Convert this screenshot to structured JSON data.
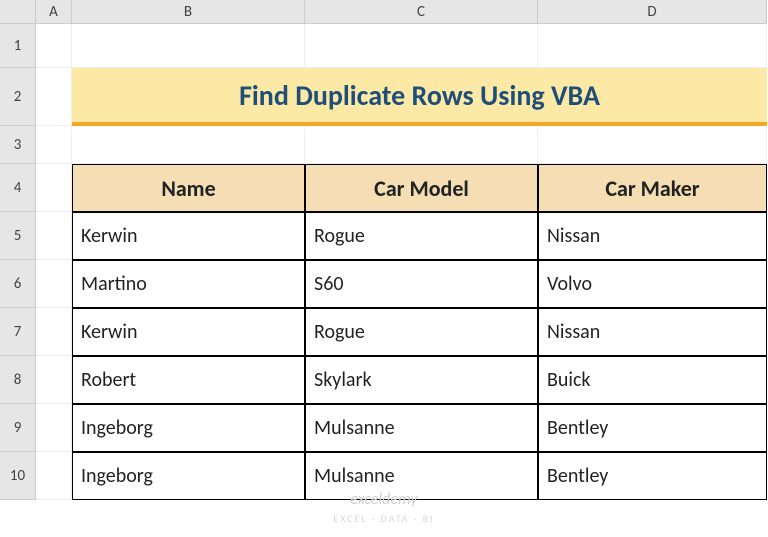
{
  "columns": [
    "A",
    "B",
    "C",
    "D"
  ],
  "rows": [
    "1",
    "2",
    "3",
    "4",
    "5",
    "6",
    "7",
    "8",
    "9",
    "10"
  ],
  "title": "Find Duplicate Rows Using VBA",
  "headers": {
    "name": "Name",
    "car_model": "Car Model",
    "car_maker": "Car Maker"
  },
  "data": [
    {
      "name": "Kerwin",
      "car_model": "Rogue",
      "car_maker": "Nissan"
    },
    {
      "name": "Martino",
      "car_model": "S60",
      "car_maker": "Volvo"
    },
    {
      "name": "Kerwin",
      "car_model": "Rogue",
      "car_maker": "Nissan"
    },
    {
      "name": "Robert",
      "car_model": "Skylark",
      "car_maker": "Buick"
    },
    {
      "name": "Ingeborg",
      "car_model": "Mulsanne",
      "car_maker": "Bentley"
    },
    {
      "name": "Ingeborg",
      "car_model": "Mulsanne",
      "car_maker": "Bentley"
    }
  ],
  "watermark": "exceldemy",
  "watermark_sub": "EXCEL · DATA · BI",
  "chart_data": {
    "type": "table",
    "title": "Find Duplicate Rows Using VBA",
    "columns": [
      "Name",
      "Car Model",
      "Car Maker"
    ],
    "rows": [
      [
        "Kerwin",
        "Rogue",
        "Nissan"
      ],
      [
        "Martino",
        "S60",
        "Volvo"
      ],
      [
        "Kerwin",
        "Rogue",
        "Nissan"
      ],
      [
        "Robert",
        "Skylark",
        "Buick"
      ],
      [
        "Ingeborg",
        "Mulsanne",
        "Bentley"
      ],
      [
        "Ingeborg",
        "Mulsanne",
        "Bentley"
      ]
    ]
  }
}
